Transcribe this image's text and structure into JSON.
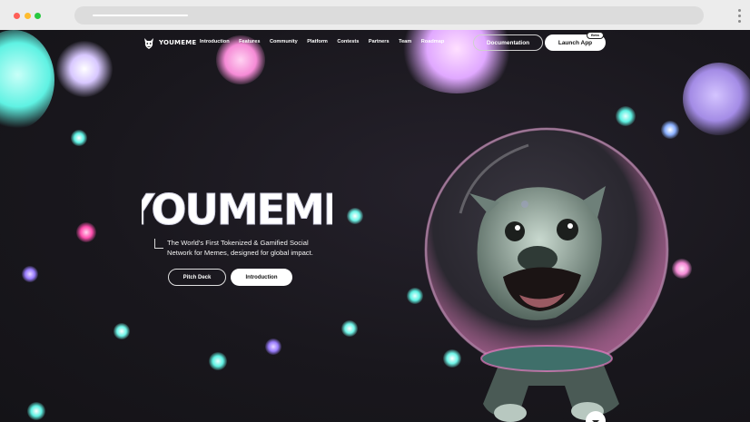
{
  "browser": {
    "controls": [
      "close",
      "minimize",
      "maximize"
    ],
    "menu_icon": "kebab-menu-icon"
  },
  "site": {
    "logo_text": "YOUMEME",
    "logo_icon": "dog-mascot-icon",
    "nav": [
      "Introduction",
      "Features",
      "Community",
      "Platform",
      "Contests",
      "Partners",
      "Team",
      "Roadmap"
    ],
    "documentation_label": "Documentation",
    "launch_label": "Launch App",
    "beta_badge": "Beta"
  },
  "hero": {
    "title": "YOUMEME",
    "tagline": "The World's First Tokenized & Gamified Social Network for Memes, designed for global impact.",
    "pitch_deck_label": "Pitch Deck",
    "introduction_label": "Introduction"
  },
  "colors": {
    "background": "#19171d",
    "accent_cyan": "#5ff2e3",
    "accent_pink": "#f58bd6",
    "accent_lavender": "#c9b7ff"
  }
}
